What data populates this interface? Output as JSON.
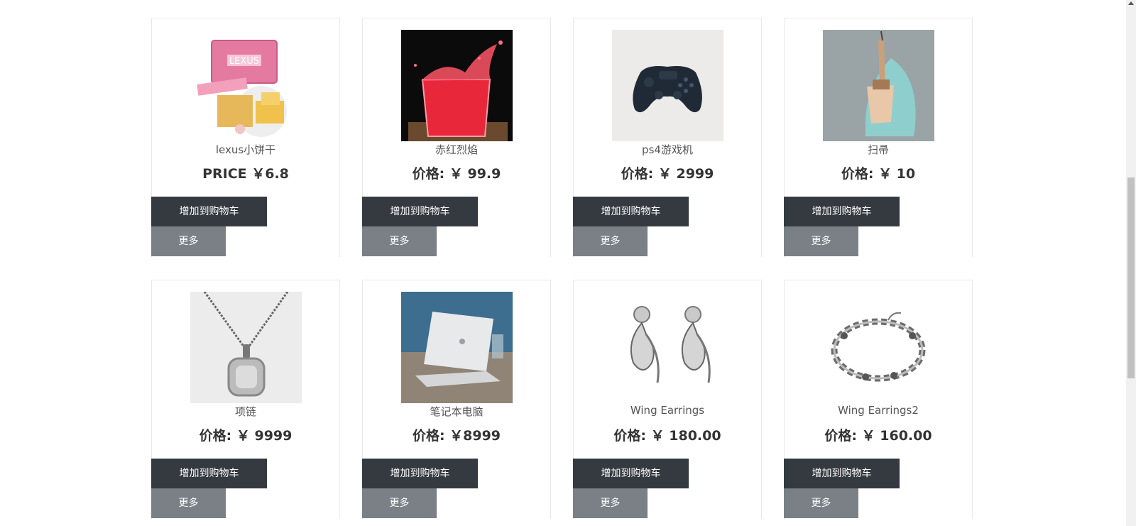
{
  "products": [
    {
      "name": "lexus小饼干",
      "price": "PRICE ￥6.8",
      "cart_label": "增加到购物车",
      "more_label": "更多",
      "image": "biscuit-pack"
    },
    {
      "name": "赤红烈焰",
      "price": "价格: ￥ 99.9",
      "cart_label": "增加到购物车",
      "more_label": "更多",
      "image": "red-drink"
    },
    {
      "name": "ps4游戏机",
      "price": "价格: ￥ 2999",
      "cart_label": "增加到购物车",
      "more_label": "更多",
      "image": "game-controller"
    },
    {
      "name": "扫帚",
      "price": "价格: ￥ 10",
      "cart_label": "增加到购物车",
      "more_label": "更多",
      "image": "brush-dustpan"
    },
    {
      "name": "项链",
      "price": "价格: ￥ 9999",
      "cart_label": "增加到购物车",
      "more_label": "更多",
      "image": "necklace"
    },
    {
      "name": "笔记本电脑",
      "price": "价格: ￥8999",
      "cart_label": "增加到购物车",
      "more_label": "更多",
      "image": "laptop"
    },
    {
      "name": "Wing Earrings",
      "price": "价格: ￥ 180.00",
      "cart_label": "增加到购物车",
      "more_label": "更多",
      "image": "earrings"
    },
    {
      "name": "Wing Earrings2",
      "price": "价格: ￥ 160.00",
      "cart_label": "增加到购物车",
      "more_label": "更多",
      "image": "bracelet"
    }
  ],
  "colors": {
    "cart_button": "#343a40",
    "more_button": "#7a8086",
    "price_text": "#333333",
    "name_text": "#555555"
  }
}
